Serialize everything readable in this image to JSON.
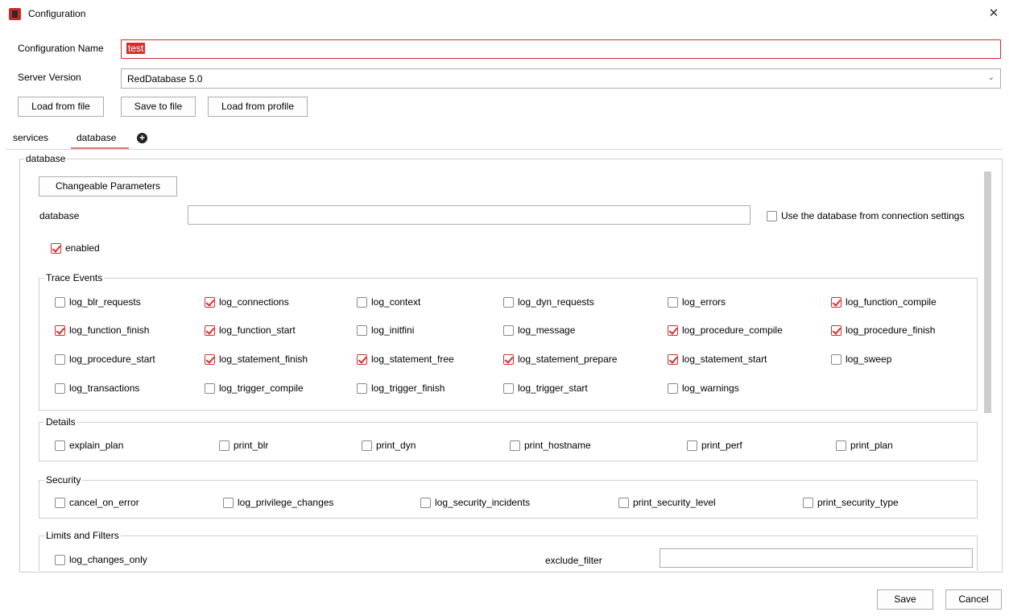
{
  "window": {
    "title": "Configuration",
    "close_glyph": "✕"
  },
  "form": {
    "config_name_label": "Configuration Name",
    "config_name_value": "test",
    "server_version_label": "Server Version",
    "server_version_value": "RedDatabase 5.0"
  },
  "toolbar": {
    "load_from_file": "Load from file",
    "save_to_file": "Save to file",
    "load_from_profile": "Load from profile"
  },
  "tabs": [
    {
      "label": "services",
      "active": false
    },
    {
      "label": "database",
      "active": true
    }
  ],
  "database_panel": {
    "legend": "database",
    "changeable_params_button": "Changeable Parameters",
    "database_label": "database",
    "database_value": "",
    "use_db_from_connection": {
      "label": "Use the database from connection settings",
      "checked": false
    },
    "enabled": {
      "label": "enabled",
      "checked": true
    }
  },
  "trace_events": {
    "legend": "Trace Events",
    "items": [
      {
        "label": "log_blr_requests",
        "checked": false
      },
      {
        "label": "log_connections",
        "checked": true
      },
      {
        "label": "log_context",
        "checked": false
      },
      {
        "label": "log_dyn_requests",
        "checked": false
      },
      {
        "label": "log_errors",
        "checked": false
      },
      {
        "label": "log_function_compile",
        "checked": true
      },
      {
        "label": "log_function_finish",
        "checked": true
      },
      {
        "label": "log_function_start",
        "checked": true
      },
      {
        "label": "log_initfini",
        "checked": false
      },
      {
        "label": "log_message",
        "checked": false
      },
      {
        "label": "log_procedure_compile",
        "checked": true
      },
      {
        "label": "log_procedure_finish",
        "checked": true
      },
      {
        "label": "log_procedure_start",
        "checked": false
      },
      {
        "label": "log_statement_finish",
        "checked": true
      },
      {
        "label": "log_statement_free",
        "checked": true
      },
      {
        "label": "log_statement_prepare",
        "checked": true
      },
      {
        "label": "log_statement_start",
        "checked": true
      },
      {
        "label": "log_sweep",
        "checked": false
      },
      {
        "label": "log_transactions",
        "checked": false
      },
      {
        "label": "log_trigger_compile",
        "checked": false
      },
      {
        "label": "log_trigger_finish",
        "checked": false
      },
      {
        "label": "log_trigger_start",
        "checked": false
      },
      {
        "label": "log_warnings",
        "checked": false
      }
    ]
  },
  "details": {
    "legend": "Details",
    "items": [
      {
        "label": "explain_plan",
        "checked": false
      },
      {
        "label": "print_blr",
        "checked": false
      },
      {
        "label": "print_dyn",
        "checked": false
      },
      {
        "label": "print_hostname",
        "checked": false
      },
      {
        "label": "print_perf",
        "checked": false
      },
      {
        "label": "print_plan",
        "checked": false
      }
    ]
  },
  "security": {
    "legend": "Security",
    "items": [
      {
        "label": "cancel_on_error",
        "checked": false
      },
      {
        "label": "log_privilege_changes",
        "checked": false
      },
      {
        "label": "log_security_incidents",
        "checked": false
      },
      {
        "label": "print_security_level",
        "checked": false
      },
      {
        "label": "print_security_type",
        "checked": false
      }
    ]
  },
  "limits": {
    "legend": "Limits and Filters",
    "log_changes_only": {
      "label": "log_changes_only",
      "checked": false
    },
    "exclude_filter_label": "exclude_filter",
    "exclude_filter_value": ""
  },
  "footer": {
    "save": "Save",
    "cancel": "Cancel"
  },
  "colors": {
    "accent": "#d32f2f",
    "tab_underline": "#e57373"
  },
  "icons": {
    "app": "app-database-icon",
    "close": "close-icon",
    "add_tab": "plus-circle-icon",
    "dropdown": "chevron-down-icon"
  }
}
